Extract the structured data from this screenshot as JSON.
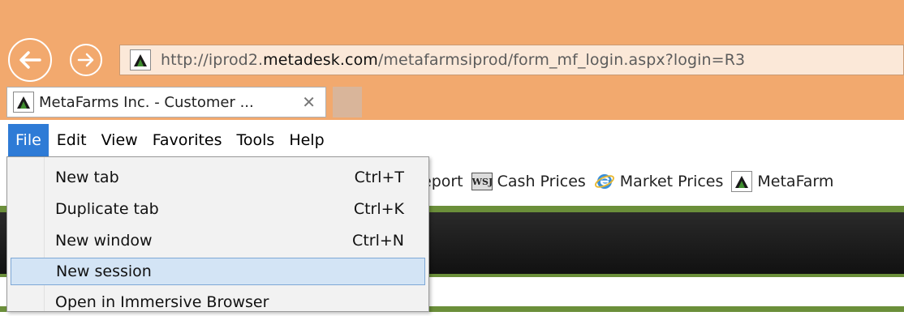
{
  "browser": {
    "address": {
      "url_prefix": "http://iprod2.",
      "url_host": "metadesk.com",
      "url_suffix": "/metafarmsiprod/form_mf_login.aspx?login=R3"
    },
    "tab": {
      "title": "MetaFarms Inc. - Customer ...",
      "close_glyph": "✕"
    },
    "colors": {
      "chrome": "#f2a96e",
      "menu_active": "#2e7bd6",
      "menu_highlight": "#d3e4f5",
      "page_green": "#6b8f3a"
    }
  },
  "menubar": {
    "items": [
      "File",
      "Edit",
      "View",
      "Favorites",
      "Tools",
      "Help"
    ]
  },
  "favorites": {
    "items": [
      {
        "label": "eport",
        "icon": "none"
      },
      {
        "label": "Cash Prices",
        "icon": "wsj-icon",
        "icon_text": "WSJ"
      },
      {
        "label": "Market Prices",
        "icon": "ie-icon"
      },
      {
        "label": "MetaFarm",
        "icon": "metafarms-icon"
      }
    ]
  },
  "file_menu": {
    "items": [
      {
        "label": "New tab",
        "shortcut": "Ctrl+T"
      },
      {
        "label": "Duplicate tab",
        "shortcut": "Ctrl+K"
      },
      {
        "label": "New window",
        "shortcut": "Ctrl+N"
      },
      {
        "label": "New session",
        "shortcut": "",
        "highlighted": true
      },
      {
        "label": "Open in Immersive Browser",
        "shortcut": ""
      }
    ]
  }
}
